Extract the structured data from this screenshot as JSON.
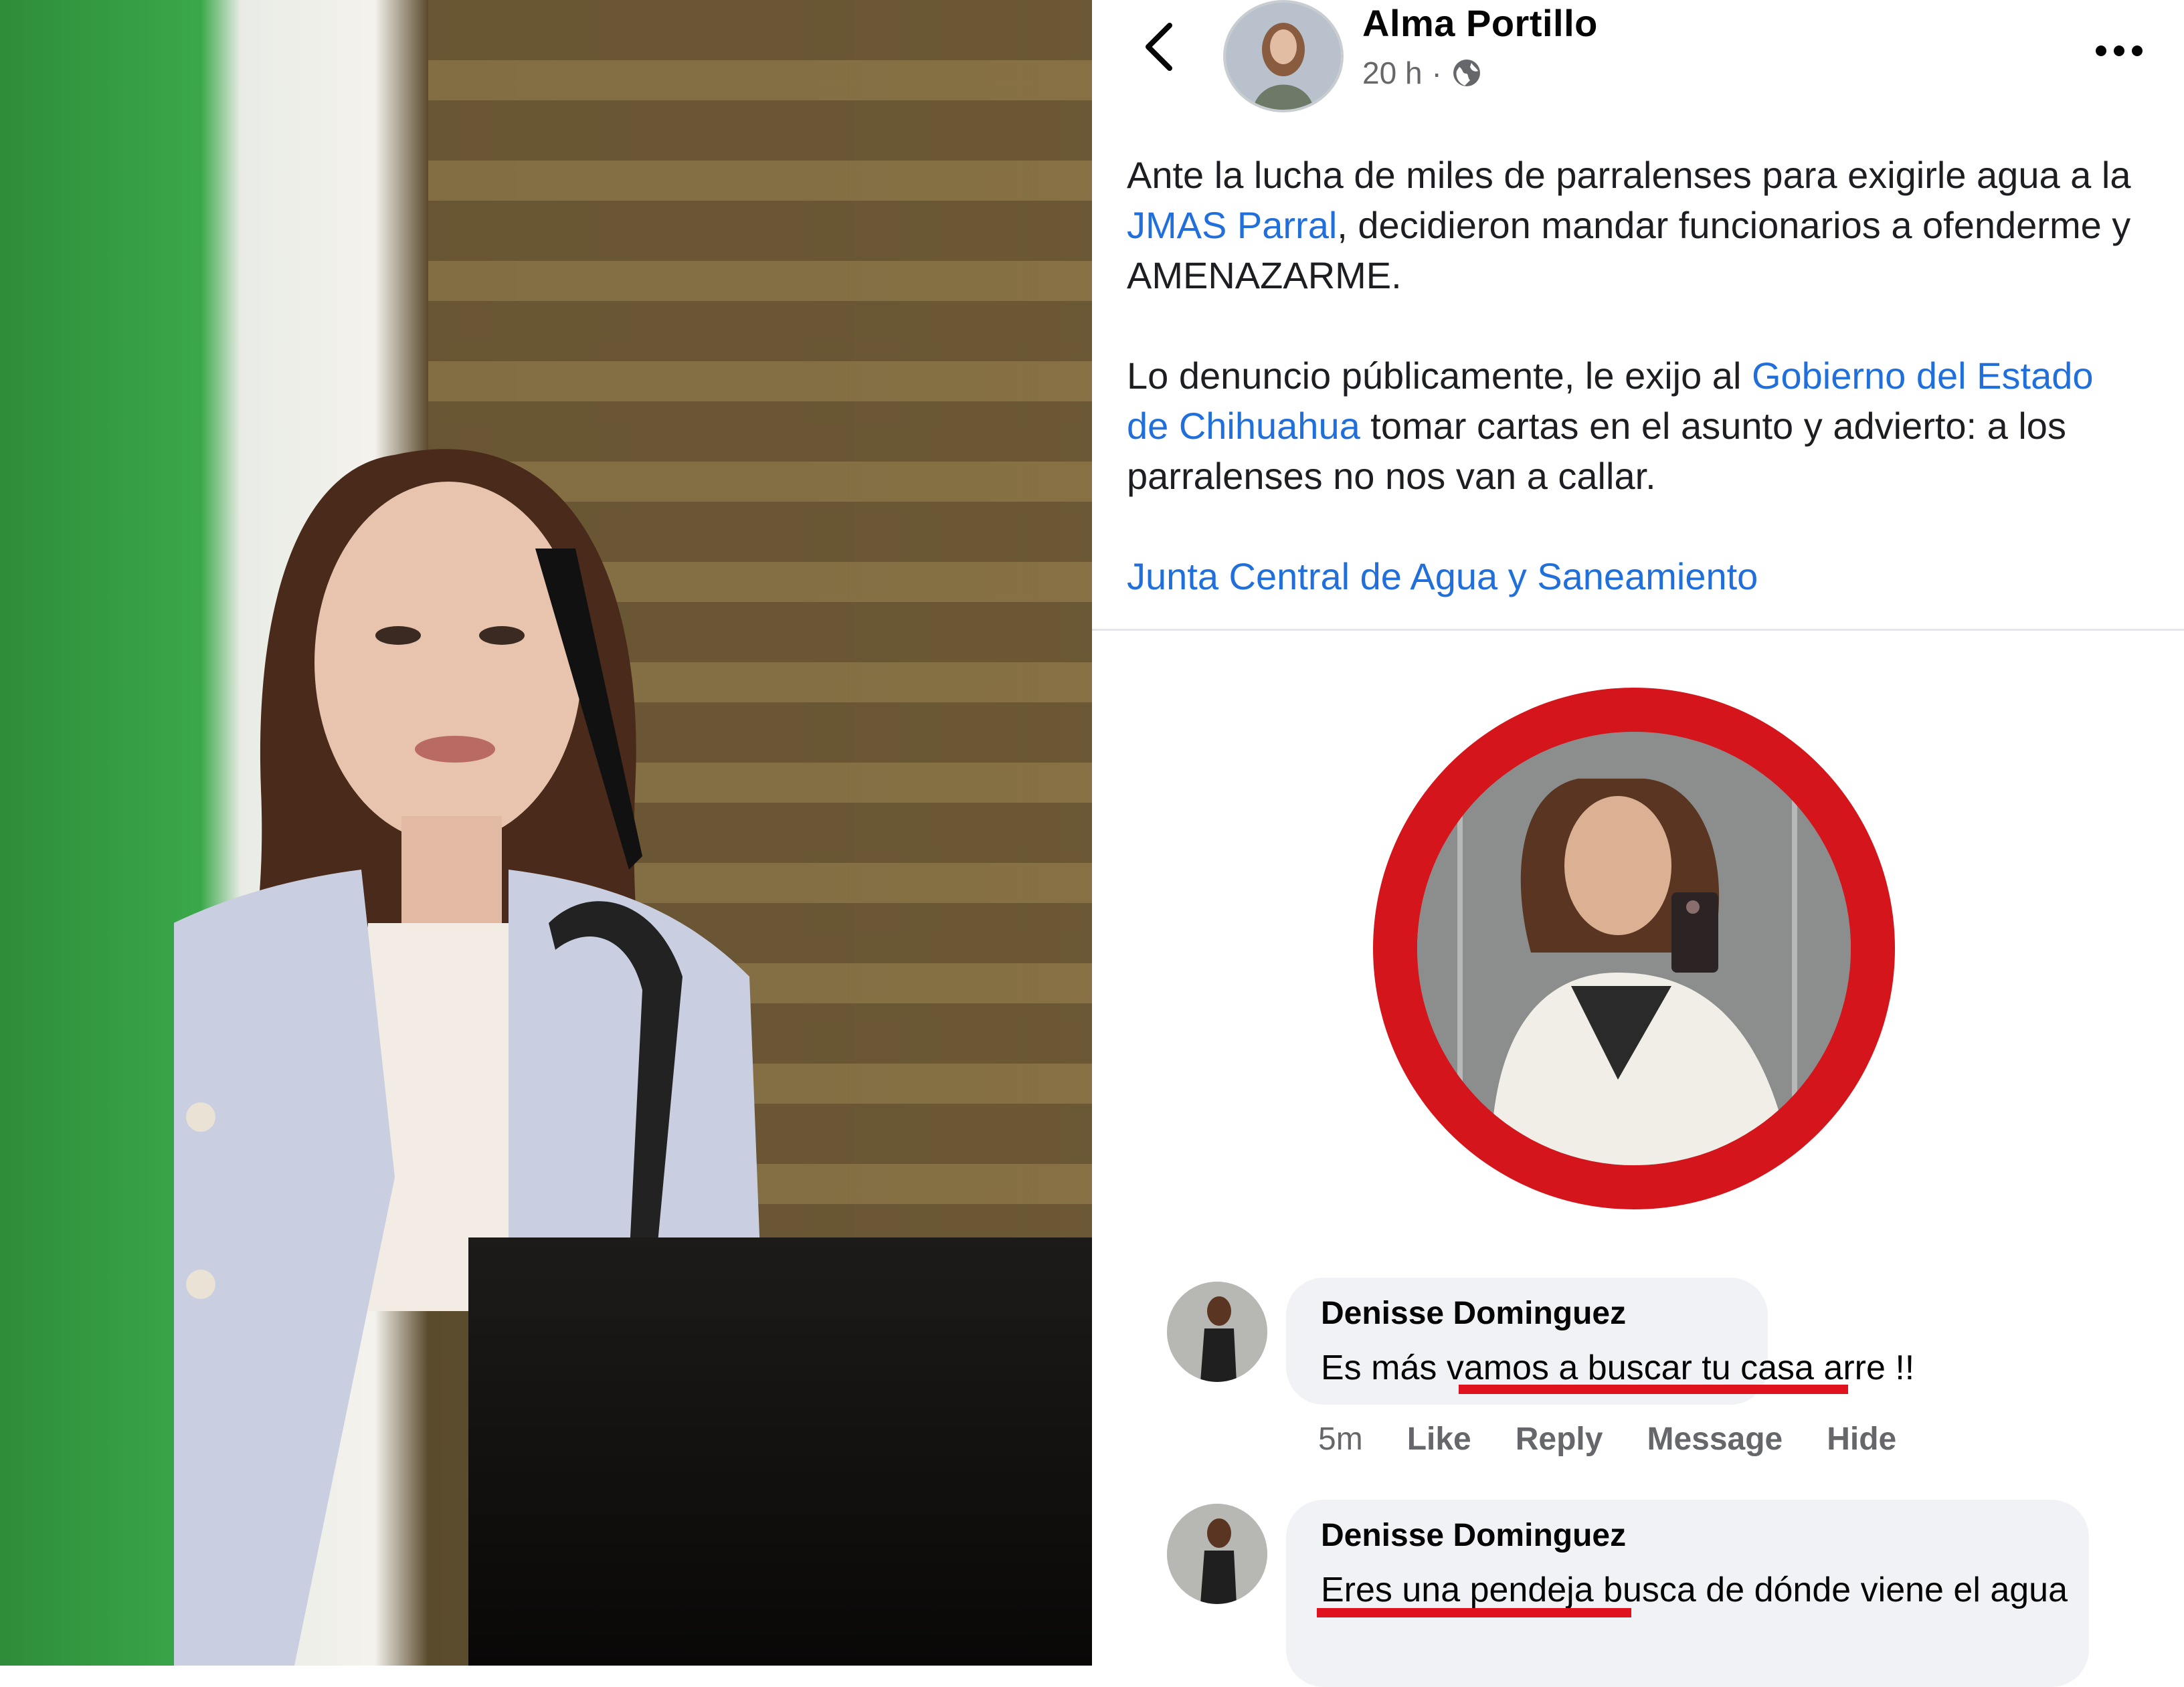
{
  "post": {
    "author": "Alma Portillo",
    "time": "20 h",
    "separator": "·",
    "paragraph1": {
      "before": "Ante la lucha de miles de parralenses para exigirle agua a la ",
      "link": "JMAS Parral",
      "after": ", decidieron mandar funcionarios a ofenderme y AMENAZARME."
    },
    "paragraph2": {
      "before": "Lo denuncio públicamente, le exijo al ",
      "link": "Gobierno del Estado de Chihuahua",
      "after": " tomar cartas en el asunto y advierto: a los parralenses no nos van a callar."
    },
    "tag_link": "Junta Central de Agua y Saneamiento"
  },
  "comments": [
    {
      "name": "Denisse Dominguez",
      "text": "Es más vamos a buscar tu casa arre !!",
      "time": "5m",
      "actions": [
        "Like",
        "Reply",
        "Message",
        "Hide"
      ]
    },
    {
      "name": "Denisse Dominguez",
      "text": "Eres una pendeja busca de dónde viene el agua"
    }
  ],
  "icons": {
    "back": "chevron-left-icon",
    "more": "more-horizontal-icon",
    "privacy": "globe-icon"
  },
  "colors": {
    "link": "#216fdb",
    "highlight_red": "#d4161c",
    "underline_red": "#e0121d",
    "muted": "#65676b",
    "bubble": "#f0f2f5"
  }
}
